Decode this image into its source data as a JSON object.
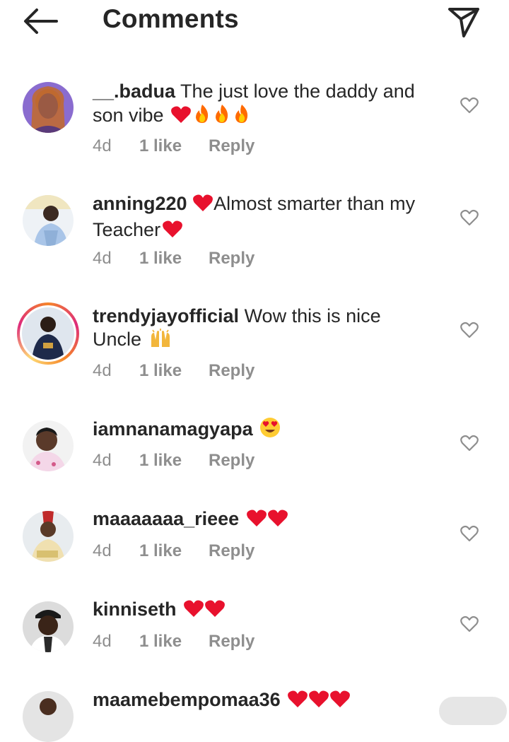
{
  "header": {
    "title": "Comments"
  },
  "comments": [
    {
      "username": "__.badua",
      "text": " The just love the daddy and son vibe",
      "emojis": [
        "red-heart",
        "fire",
        "fire",
        "fire"
      ],
      "time": "4d",
      "likes": "1 like",
      "reply": "Reply"
    },
    {
      "username": "anning220",
      "text": "Almost smarter than my Teacher",
      "emojis": [
        "red-heart",
        "red-heart"
      ],
      "time": "4d",
      "likes": "1 like",
      "reply": "Reply"
    },
    {
      "username": "trendyjayofficial",
      "text": " Wow this is nice Uncle",
      "emojis": [
        "raising-hands"
      ],
      "time": "4d",
      "likes": "1 like",
      "reply": "Reply"
    },
    {
      "username": "iamnanamagyapa",
      "text": "",
      "emojis": [
        "heart-eyes"
      ],
      "time": "4d",
      "likes": "1 like",
      "reply": "Reply"
    },
    {
      "username": "maaaaaaa_rieee",
      "text": "",
      "emojis": [
        "red-heart",
        "red-heart"
      ],
      "time": "4d",
      "likes": "1 like",
      "reply": "Reply"
    },
    {
      "username": "kinniseth",
      "text": "",
      "emojis": [
        "red-heart",
        "red-heart"
      ],
      "time": "4d",
      "likes": "1 like",
      "reply": "Reply"
    },
    {
      "username": "maamebempomaa36",
      "text": "",
      "emojis": [
        "red-heart",
        "red-heart",
        "red-heart"
      ]
    }
  ],
  "colors": {
    "text": "#262626",
    "meta": "#8e8e8e",
    "heart": "#e8112d",
    "story_ring_start": "#f58529",
    "story_ring_end": "#dd2a7b"
  }
}
